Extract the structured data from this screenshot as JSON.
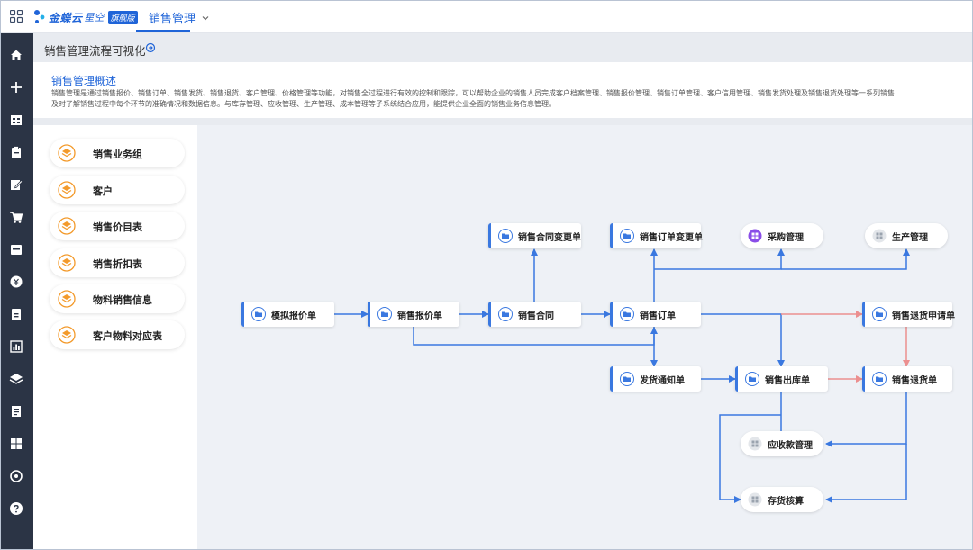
{
  "header": {
    "brand_name": "金蝶云",
    "brand_sub": "星空",
    "brand_badge": "旗舰版",
    "module": "销售管理"
  },
  "page": {
    "title": "销售管理流程可视化"
  },
  "overview": {
    "title": "销售管理概述",
    "text_line1": "销售管理是通过销售报价、销售订单、销售发货、销售退货、客户管理、价格管理等功能，对销售全过程进行有效的控制和跟踪，可以帮助企业的销售人员完成客户档案管理、销售报价管理、销售订单管理、客户信用管理、销售发货处理及销售退货处理等一系列销售",
    "text_line2": "及时了解销售过程中每个环节的准确情况和数据信息。与库存管理、应收管理、生产管理、成本管理等子系统结合应用，能提供企业全面的销售业务信息管理。"
  },
  "left_list": {
    "items": [
      {
        "label": "销售业务组"
      },
      {
        "label": "客户"
      },
      {
        "label": "销售价目表"
      },
      {
        "label": "销售折扣表"
      },
      {
        "label": "物料销售信息"
      },
      {
        "label": "客户物料对应表"
      }
    ]
  },
  "flow": {
    "nodes": {
      "quote_sim": "模拟报价单",
      "quote": "销售报价单",
      "contract": "销售合同",
      "order": "销售订单",
      "contract_change": "销售合同变更单",
      "order_change": "销售订单变更单",
      "purchase": "采购管理",
      "production": "生产管理",
      "return_request": "销售退货申请单",
      "delivery_notice": "发货通知单",
      "outbound": "销售出库单",
      "return_order": "销售退货单",
      "receivable": "应收款管理",
      "inventory_cost": "存货核算"
    }
  },
  "colors": {
    "primary": "#1f64d8",
    "edge_blue": "#3a78e0",
    "edge_red": "#ec8f8f",
    "icon_orange": "#f39a2b",
    "icon_purple": "#8a4de8",
    "icon_gray": "#9aa3ae",
    "nav_bg": "#2b3445"
  },
  "icons": {
    "left_list": "layers-icon",
    "document_node": "folder-icon",
    "purchase": "apps-icon",
    "system_node": "grid-icon"
  }
}
